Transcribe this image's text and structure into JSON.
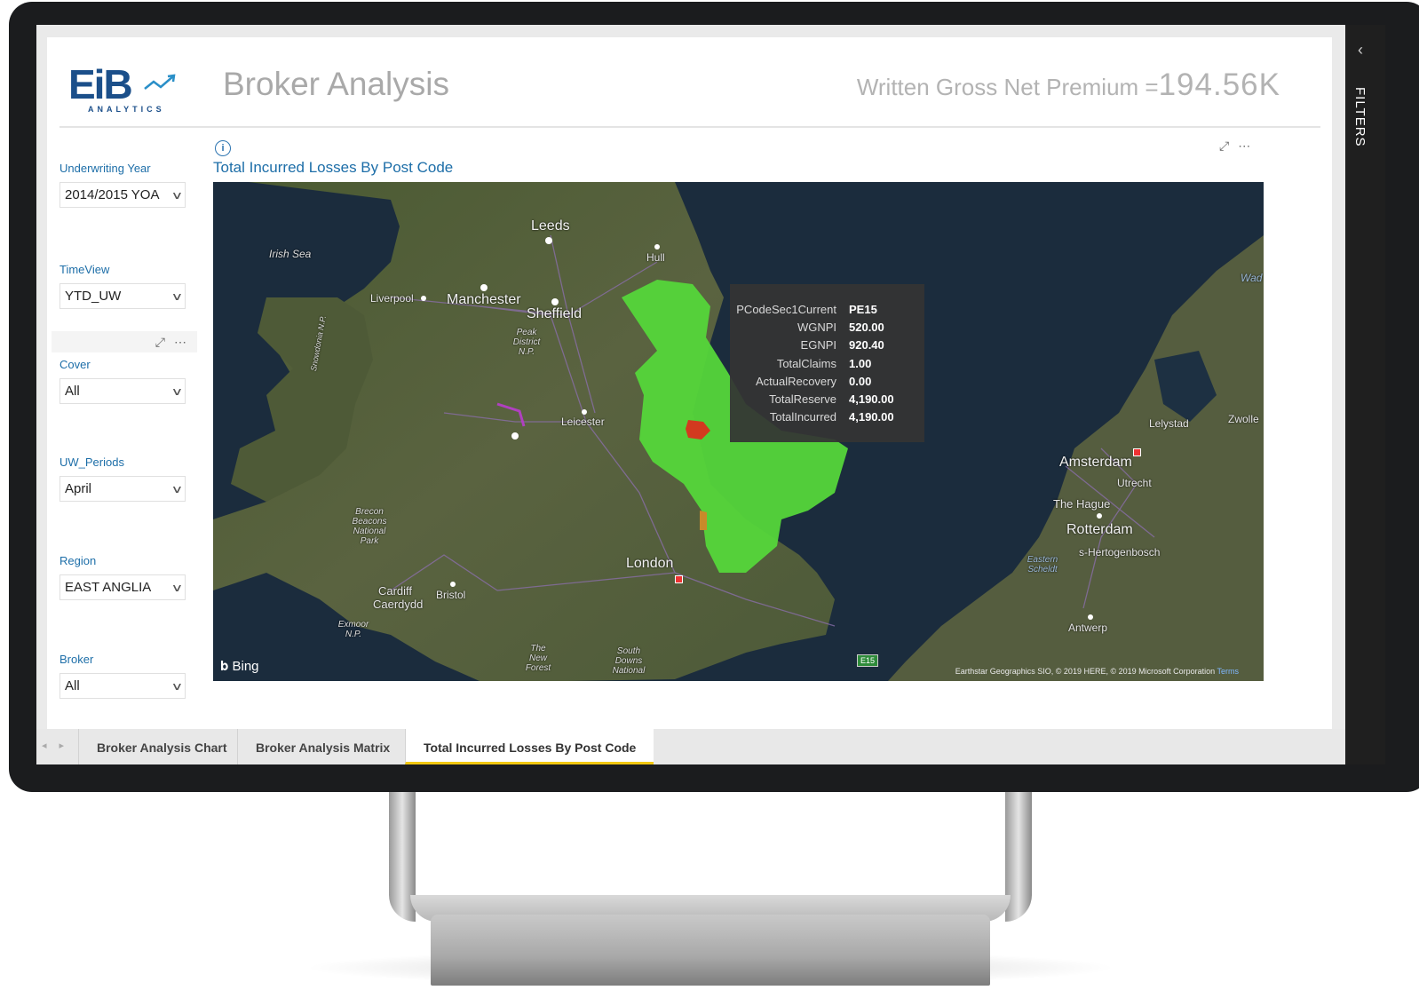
{
  "header": {
    "logo_text": "EiB",
    "logo_sub": "ANALYTICS",
    "title": "Broker Analysis",
    "kpi_label": "Written Gross Net Premium =",
    "kpi_value": "194.56K"
  },
  "slicers": [
    {
      "label": "Underwriting Year",
      "value": "2014/2015 YOA"
    },
    {
      "label": "TimeView",
      "value": "YTD_UW"
    },
    {
      "label": "Cover",
      "value": "All"
    },
    {
      "label": "UW_Periods",
      "value": "April"
    },
    {
      "label": "Region",
      "value": "EAST ANGLIA"
    },
    {
      "label": "Broker",
      "value": "All"
    }
  ],
  "visual": {
    "title": "Total Incurred Losses By Post Code",
    "info_icon": "info-icon",
    "focus_icon": "focus-mode-icon",
    "more_icon": "more-options-icon"
  },
  "map": {
    "cities": {
      "leeds": "Leeds",
      "hull": "Hull",
      "irish_sea": "Irish Sea",
      "liverpool": "Liverpool",
      "manchester": "Manchester",
      "sheffield": "Sheffield",
      "peak": "Peak District N.P.",
      "snowdonia": "Snowdonia N.P.",
      "leicester": "Leicester",
      "brecon": "Brecon Beacons National Park",
      "cardiff": "Cardiff Caerdydd",
      "bristol": "Bristol",
      "exmoor": "Exmoor N.P.",
      "new_forest": "The New Forest",
      "south_downs": "South Downs National",
      "london": "London",
      "amsterdam": "Amsterdam",
      "utrecht": "Utrecht",
      "the_hague": "The Hague",
      "rotterdam": "Rotterdam",
      "hertogenbosch": "s-Hertogenbosch",
      "eastern_scheldt": "Eastern Scheldt",
      "antwerp": "Antwerp",
      "lelystad": "Lelystad",
      "zwolle": "Zwolle",
      "wad": "Wad"
    },
    "bing": "Bing",
    "road_badge": "E15",
    "attribution": "Earthstar Geographics SIO, © 2019 HERE, © 2019 Microsoft Corporation",
    "terms": "Terms",
    "colors": {
      "region_fill": "#55d63a",
      "highlight": "#d23a1f",
      "sea": "#1b2c3d",
      "land": "#4e5a36"
    }
  },
  "tooltip": [
    {
      "label": "PCodeSec1Current",
      "value": "PE15"
    },
    {
      "label": "WGNPI",
      "value": "520.00"
    },
    {
      "label": "EGNPI",
      "value": "920.40"
    },
    {
      "label": "TotalClaims",
      "value": "1.00"
    },
    {
      "label": "ActualRecovery",
      "value": "0.00"
    },
    {
      "label": "TotalReserve",
      "value": "4,190.00"
    },
    {
      "label": "TotalIncurred",
      "value": "4,190.00"
    }
  ],
  "tabs": [
    {
      "label": "Broker Analysis Chart",
      "active": false
    },
    {
      "label": "Broker Analysis Matrix",
      "active": false
    },
    {
      "label": "Total Incurred Losses By Post Code",
      "active": true
    }
  ],
  "filters_pane": {
    "label": "FILTERS"
  }
}
